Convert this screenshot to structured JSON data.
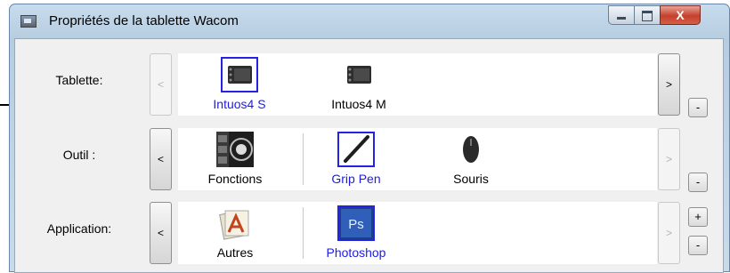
{
  "window": {
    "title": "Propriétés de la tablette Wacom",
    "controls": {
      "close": "X"
    }
  },
  "rows": {
    "tablet": {
      "label": "Tablette:",
      "prev": "<",
      "next": ">",
      "remove": "-",
      "items": [
        {
          "label": "Intuos4 S",
          "icon": "tablet-icon",
          "selected": true
        },
        {
          "label": "Intuos4 M",
          "icon": "tablet-icon",
          "selected": false
        }
      ]
    },
    "tool": {
      "label": "Outil :",
      "prev": "<",
      "next": ">",
      "remove": "-",
      "items": [
        {
          "label": "Fonctions",
          "icon": "functions-icon",
          "selected": false
        },
        {
          "label": "Grip Pen",
          "icon": "pen-icon",
          "selected": true
        },
        {
          "label": "Souris",
          "icon": "mouse-icon",
          "selected": false
        }
      ]
    },
    "application": {
      "label": "Application:",
      "prev": "<",
      "next": ">",
      "add": "+",
      "remove": "-",
      "items": [
        {
          "label": "Autres",
          "icon": "other-apps-icon",
          "selected": false
        },
        {
          "label": "Photoshop",
          "icon": "photoshop-icon",
          "icon_text": "Ps",
          "selected": true
        }
      ]
    }
  },
  "colors": {
    "selection": "#1c1ce6",
    "window_frame": "#b6cde0",
    "close": "#c4402c"
  }
}
